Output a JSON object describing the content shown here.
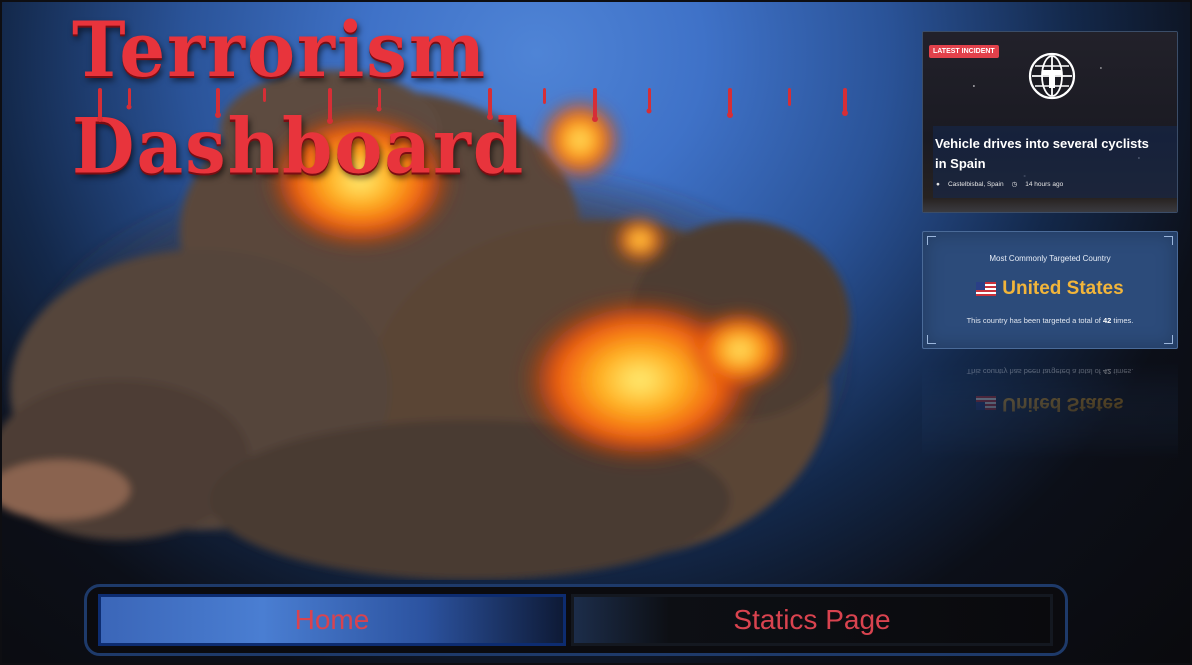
{
  "header": {
    "title": "Terrorism Dashboard"
  },
  "latest_incident": {
    "badge": "LATEST INCIDENT",
    "icon": "globe-icon",
    "title": "Vehicle drives into several cyclists in Spain",
    "location": "Castelbisbal, Spain",
    "time_ago": "14 hours ago"
  },
  "targeted_country": {
    "label": "Most Commonly Targeted Country",
    "flag_icon": "us-flag-icon",
    "country": "United States",
    "desc_prefix": "This country has been targeted a total of",
    "count": "42",
    "desc_suffix": "times.",
    "accent_color": "#f2b53a"
  },
  "nav": {
    "home_label": "Home",
    "stats_label": "Statics Page"
  },
  "colors": {
    "title_red": "#e8343c",
    "nav_text": "#d9434f",
    "badge_red": "#e2414b"
  }
}
